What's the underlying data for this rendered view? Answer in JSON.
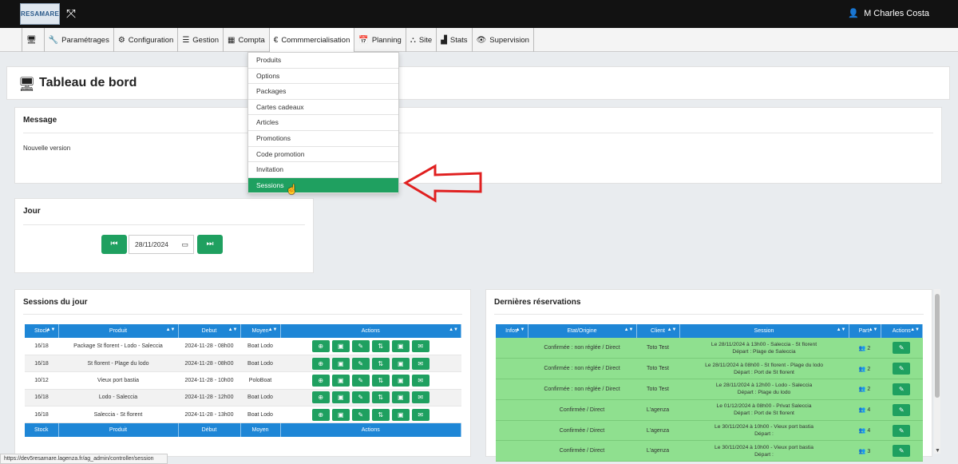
{
  "app": {
    "logo_text": "RESAMARE",
    "user_name": "M Charles Costa"
  },
  "nav": [
    {
      "icon": "monitor-icon",
      "label": ""
    },
    {
      "icon": "wrench-icon",
      "label": "Paramétrages"
    },
    {
      "icon": "gears-icon",
      "label": "Configuration"
    },
    {
      "icon": "list-icon",
      "label": "Gestion"
    },
    {
      "icon": "calculator-icon",
      "label": "Compta"
    },
    {
      "icon": "euro-icon",
      "label": "Commmercialisation"
    },
    {
      "icon": "calendar-icon",
      "label": "Planning"
    },
    {
      "icon": "sitemap-icon",
      "label": "Site"
    },
    {
      "icon": "chart-icon",
      "label": "Stats"
    },
    {
      "icon": "eye-icon",
      "label": "Supervision"
    }
  ],
  "dropdown": [
    "Produits",
    "Options",
    "Packages",
    "Cartes cadeaux",
    "Articles",
    "Promotions",
    "Code promotion",
    "Invitation",
    "Sessions"
  ],
  "page": {
    "title": "Tableau de bord"
  },
  "message": {
    "title": "Message",
    "text": "Nouvelle version"
  },
  "jour": {
    "title": "Jour",
    "date": "28/11/2024"
  },
  "sessions": {
    "title": "Sessions du jour",
    "headers": [
      "Stock",
      "Produit",
      "Debut",
      "Moyen",
      "Actions"
    ],
    "footers": [
      "Stock",
      "Produit",
      "Début",
      "Moyen",
      "Actions"
    ],
    "rows": [
      [
        "16/18",
        "Package St florent - Lodo - Saleccia",
        "2024-11-28 - 08h00",
        "Boat Lodo"
      ],
      [
        "16/18",
        "St florent - Plage du lodo",
        "2024-11-28 - 08h00",
        "Boat Lodo"
      ],
      [
        "10/12",
        "Vieux port bastia",
        "2024-11-28 - 10h00",
        "PoloBoat"
      ],
      [
        "16/18",
        "Lodo - Saleccia",
        "2024-11-28 - 12h00",
        "Boat Lodo"
      ],
      [
        "16/18",
        "Saleccia - St florent",
        "2024-11-28 - 13h00",
        "Boat Lodo"
      ]
    ]
  },
  "reservations": {
    "title": "Dernières réservations",
    "headers": [
      "Infos",
      "Etat/Origine",
      "Client",
      "Session",
      "Part.",
      "Actions"
    ],
    "rows": [
      {
        "etat": "Confirmée : non réglée / Direct",
        "client": "Toto Test",
        "session1": "Le 28/11/2024 à 13h00 - Saleccia - St florent",
        "session2": "Départ : Plage de Saleccia",
        "part": "2"
      },
      {
        "etat": "Confirmée : non réglée / Direct",
        "client": "Toto Test",
        "session1": "Le 28/11/2024 à 08h00 - St florent - Plage du lodo",
        "session2": "Départ : Port de St florent",
        "part": "2"
      },
      {
        "etat": "Confirmée : non réglée / Direct",
        "client": "Toto Test",
        "session1": "Le 28/11/2024 à 12h00 - Lodo - Saleccia",
        "session2": "Départ : Plage du lodo",
        "part": "2"
      },
      {
        "etat": "Confirmée / Direct",
        "client": "L'agenza",
        "session1": "Le 01/12/2024 à 08h00 - Privat Saleccia",
        "session2": "Départ : Port de St florent",
        "part": "4"
      },
      {
        "etat": "Confirmée / Direct",
        "client": "L'agenza",
        "session1": "Le 30/11/2024 à 10h00 - Vieux port bastia",
        "session2": "Départ :",
        "part": "4"
      },
      {
        "etat": "Confirmée / Direct",
        "client": "L'agenza",
        "session1": "Le 30/11/2024 à 10h00 - Vieux port bastia",
        "session2": "Départ :",
        "part": "3"
      }
    ]
  },
  "status_url": "https://dev5resamare.lagenza.fr/ag_admin/controller/session",
  "colors": {
    "green": "#1fa060",
    "blue": "#1e86d6",
    "row_green": "#8fe08f",
    "arrow_red": "#e02020"
  }
}
